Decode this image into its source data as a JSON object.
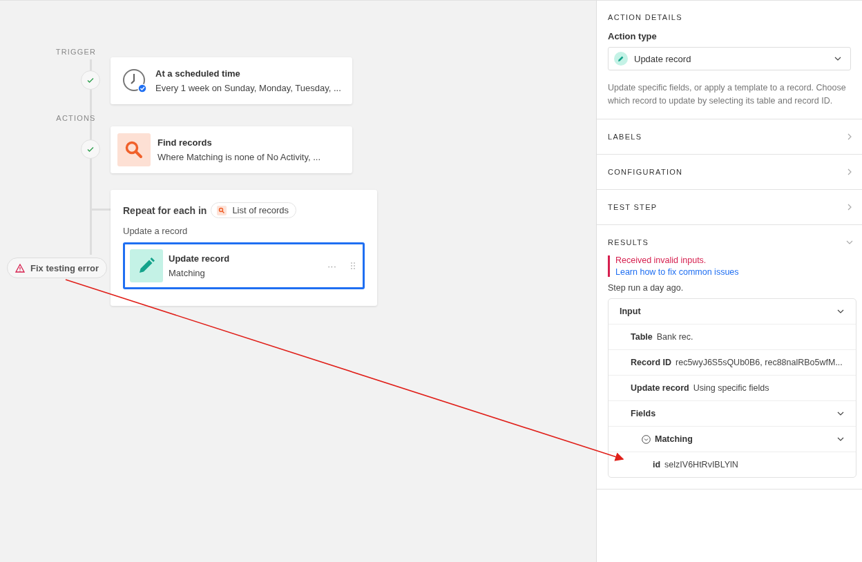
{
  "canvas": {
    "trigger_label": "TRIGGER",
    "actions_label": "ACTIONS",
    "trigger": {
      "kind": "schedule",
      "title": "At a scheduled time",
      "subtitle": "Every 1 week on Sunday, Monday, Tuesday, ...",
      "done": true
    },
    "actions": [
      {
        "kind": "find",
        "title": "Find records",
        "subtitle": "Where Matching is none of No Activity, ...",
        "done": true
      }
    ],
    "loop": {
      "label": "Repeat for each in",
      "source": "List of records",
      "caption": "Update a record",
      "step": {
        "kind": "update",
        "title": "Update record",
        "subtitle": "Matching",
        "selected": true,
        "menu": "···"
      }
    },
    "error_button": "Fix testing error"
  },
  "panel": {
    "heading": "ACTION DETAILS",
    "action_type_label": "Action type",
    "action_type": "Update record",
    "description": "Update specific fields, or apply a template to a record. Choose which record to update by selecting its table and record ID.",
    "sections": [
      {
        "title": "LABELS",
        "expanded": false
      },
      {
        "title": "CONFIGURATION",
        "expanded": false
      },
      {
        "title": "TEST STEP",
        "expanded": false
      },
      {
        "title": "RESULTS",
        "expanded": true
      }
    ],
    "results": {
      "error": "Received invalid inputs.",
      "link": "Learn how to fix common issues",
      "run_time": "Step run a day ago.",
      "tree": [
        {
          "label": "Input",
          "expanded": true,
          "children": [
            {
              "label": "Table",
              "value": "Bank rec."
            },
            {
              "label": "Record ID",
              "value": "rec5wyJ6S5sQUb0B6, rec88nalRBo5wfM..."
            },
            {
              "label": "Update record",
              "value": "Using specific fields"
            },
            {
              "label": "Fields",
              "expanded": true,
              "children": [
                {
                  "label": "Matching",
                  "kind": "object",
                  "expanded": true,
                  "children": [
                    {
                      "label": "id",
                      "value": "selzIV6HtRvIBLYlN"
                    }
                  ]
                }
              ]
            }
          ]
        }
      ]
    }
  }
}
